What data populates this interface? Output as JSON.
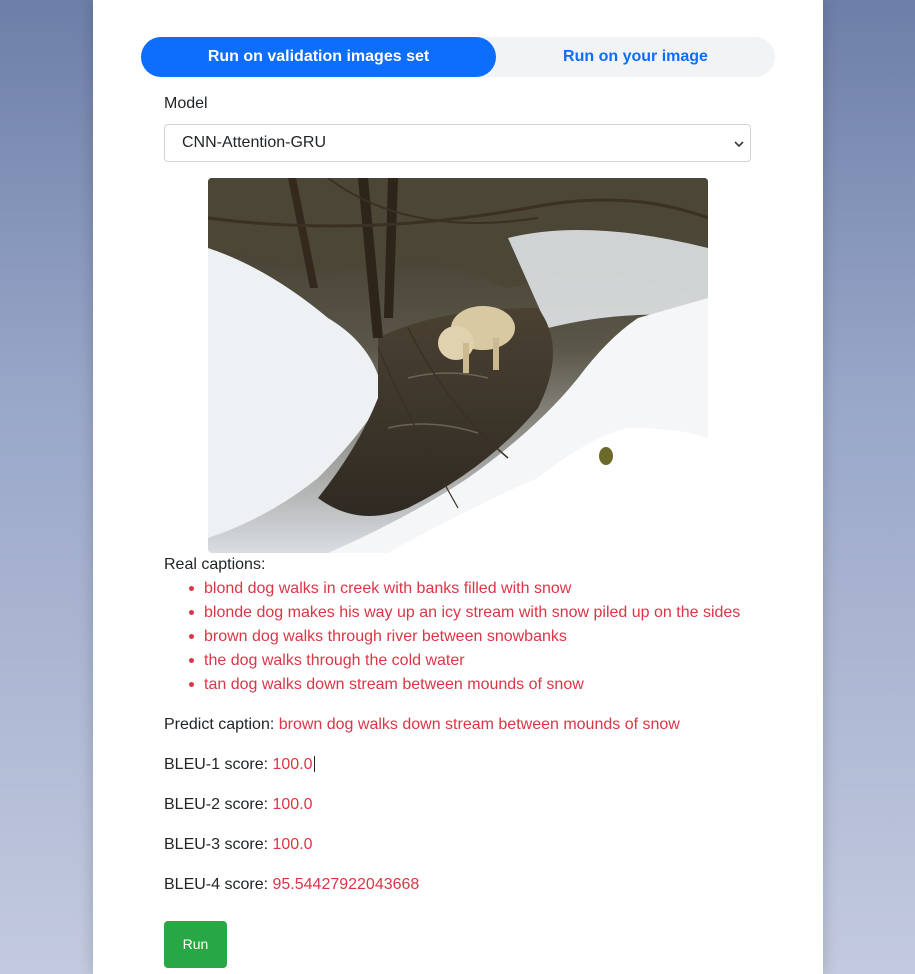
{
  "tabs": {
    "validation_label": "Run on validation images set",
    "custom_label": "Run on your image"
  },
  "model": {
    "label": "Model",
    "selected": "CNN-Attention-GRU"
  },
  "captions": {
    "label": "Real captions:",
    "items": [
      "blond dog walks in creek with banks filled with snow",
      "blonde dog makes his way up an icy stream with snow piled up on the sides",
      "brown dog walks through river between snowbanks",
      "the dog walks through the cold water",
      "tan dog walks down stream between mounds of snow"
    ]
  },
  "prediction": {
    "label": "Predict caption:",
    "value": "brown dog walks down stream between mounds of snow"
  },
  "scores": {
    "bleu1_label": "BLEU-1 score:",
    "bleu1_value": "100.0",
    "bleu2_label": "BLEU-2 score:",
    "bleu2_value": "100.0",
    "bleu3_label": "BLEU-3 score:",
    "bleu3_value": "100.0",
    "bleu4_label": "BLEU-4 score:",
    "bleu4_value": "95.54427922043668"
  },
  "run_label": "Run",
  "colors": {
    "primary": "#0d6efd",
    "danger": "#dc3545",
    "success": "#28a745"
  }
}
